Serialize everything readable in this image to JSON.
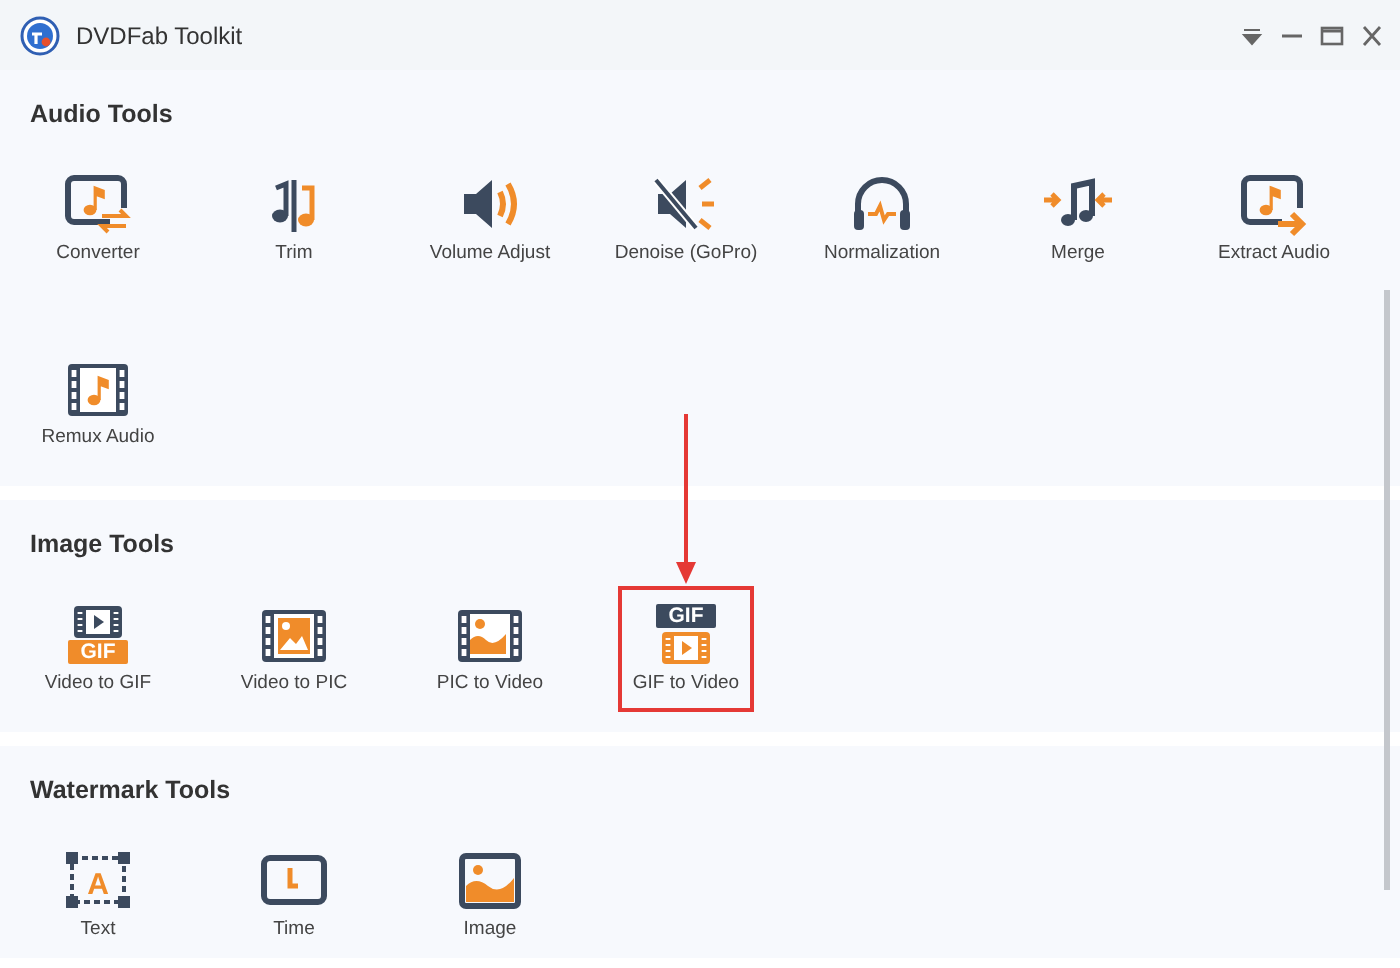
{
  "window": {
    "title": "DVDFab Toolkit"
  },
  "sections": [
    {
      "title": "Audio Tools",
      "tools": [
        {
          "label": "Converter",
          "highlighted": false
        },
        {
          "label": "Trim",
          "highlighted": false
        },
        {
          "label": "Volume Adjust",
          "highlighted": false
        },
        {
          "label": "Denoise (GoPro)",
          "highlighted": false
        },
        {
          "label": "Normalization",
          "highlighted": false
        },
        {
          "label": "Merge",
          "highlighted": false
        },
        {
          "label": "Extract Audio",
          "highlighted": false
        },
        {
          "label": "Remux Audio",
          "highlighted": false
        }
      ]
    },
    {
      "title": "Image Tools",
      "tools": [
        {
          "label": "Video to GIF",
          "highlighted": false,
          "badge": "GIF"
        },
        {
          "label": "Video to PIC",
          "highlighted": false
        },
        {
          "label": "PIC to Video",
          "highlighted": false
        },
        {
          "label": "GIF to Video",
          "highlighted": true,
          "badge": "GIF"
        }
      ]
    },
    {
      "title": "Watermark Tools",
      "tools": [
        {
          "label": "Text",
          "highlighted": false,
          "badge": "A"
        },
        {
          "label": "Time",
          "highlighted": false
        },
        {
          "label": "Image",
          "highlighted": false
        }
      ]
    }
  ]
}
